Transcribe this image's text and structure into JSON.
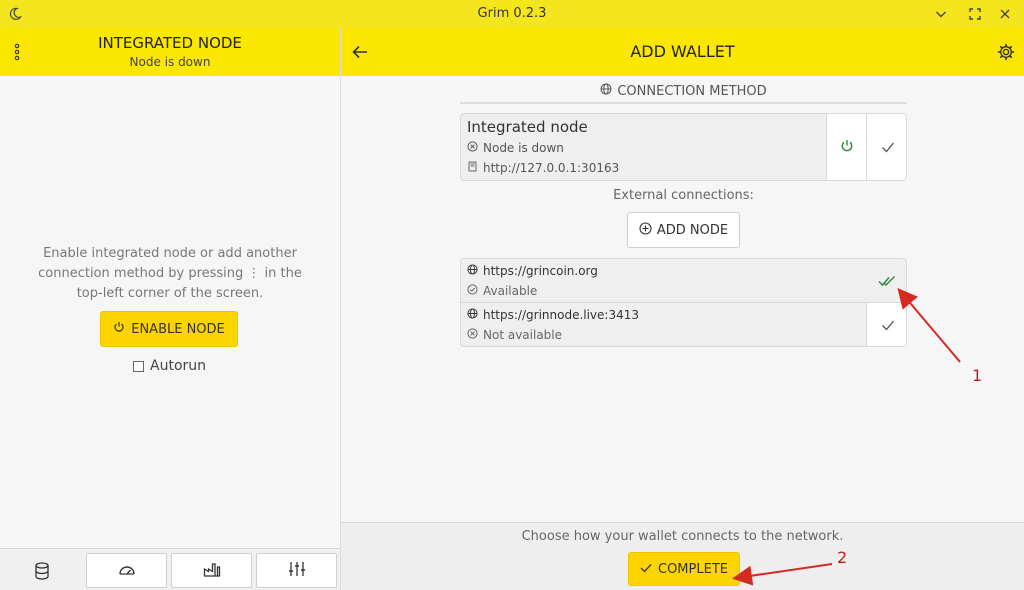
{
  "titlebar": {
    "title": "Grim 0.2.3"
  },
  "left_header": {
    "title": "INTEGRATED NODE",
    "subtitle": "Node is down"
  },
  "left_panel": {
    "hint_text": "Enable integrated node or add another connection method by pressing ⋮ in the top-left corner of the screen.",
    "enable_button": "ENABLE NODE",
    "autorun_label": "Autorun"
  },
  "right_header": {
    "title": "ADD WALLET"
  },
  "connection": {
    "section_title": "CONNECTION METHOD",
    "integrated": {
      "name": "Integrated node",
      "status": "Node is down",
      "address": "http://127.0.0.1:30163"
    },
    "external_label": "External connections:",
    "add_node_button": "ADD NODE",
    "items": [
      {
        "url": "https://grincoin.org",
        "status": "Available",
        "selected": true
      },
      {
        "url": "https://grinnode.live:3413",
        "status": "Not available",
        "selected": false
      }
    ]
  },
  "footer": {
    "hint": "Choose how your wallet connects to the network.",
    "complete_button": "COMPLETE"
  },
  "annotations": {
    "marker_1": "1",
    "marker_2": "2"
  },
  "colors": {
    "header_yellow": "#fce700",
    "button_yellow": "#fcd400",
    "titlebar_yellow": "#f4e51d",
    "check_green": "#2e8b3a",
    "annotation_red": "#d42a22"
  },
  "icons": {
    "titlebar": [
      "moon-icon",
      "chevron-down-icon",
      "fullscreen-icon",
      "close-icon"
    ],
    "left_footer": [
      "database-icon",
      "gauge-icon",
      "factory-icon",
      "sliders-icon"
    ]
  }
}
